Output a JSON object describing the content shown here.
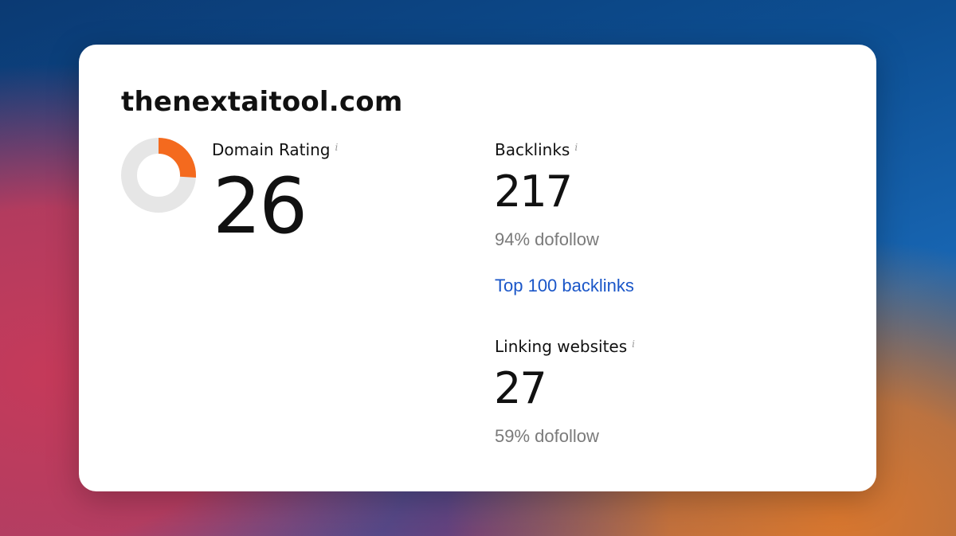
{
  "card": {
    "domain": "thenextaitool.com"
  },
  "domain_rating": {
    "label": "Domain Rating",
    "info": "i",
    "value": "26",
    "gauge_fraction": 0.26,
    "gauge_color": "#f46a1e",
    "gauge_track_color": "#e6e6e6"
  },
  "backlinks": {
    "label": "Backlinks",
    "info": "i",
    "value": "217",
    "dofollow": "94% dofollow",
    "top_link": "Top 100 backlinks"
  },
  "linking_websites": {
    "label": "Linking websites",
    "info": "i",
    "value": "27",
    "dofollow": "59% dofollow"
  },
  "colors": {
    "link": "#1a56c8",
    "muted_text": "#7a7a7a",
    "primary_text": "#111111"
  }
}
